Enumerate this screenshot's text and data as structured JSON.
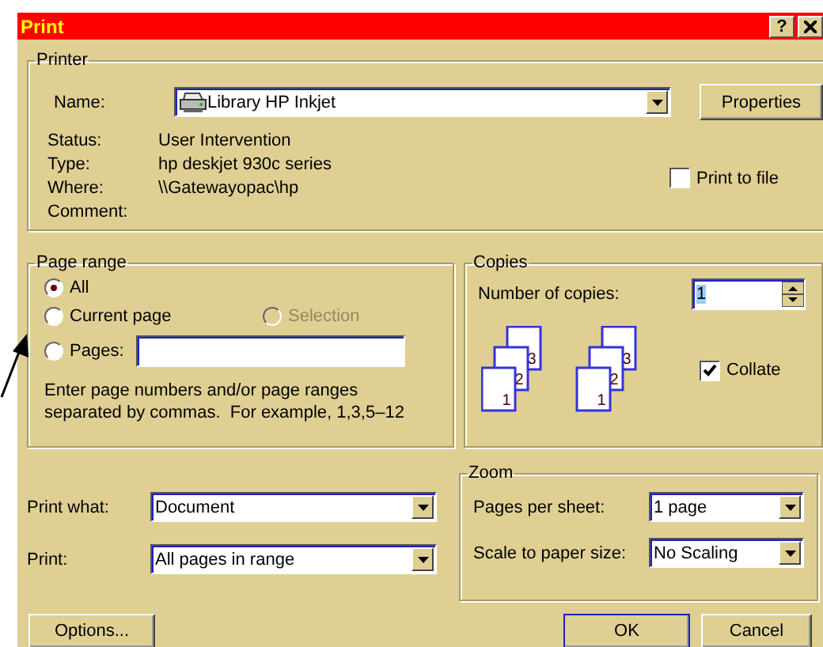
{
  "window": {
    "title": "Print",
    "help_button": "?"
  },
  "printer": {
    "label": "Printer",
    "name_label": "Name:",
    "name_value": "Library HP Inkjet",
    "properties_button": "Properties",
    "info": [
      {
        "label": "Status:",
        "value": "User Intervention"
      },
      {
        "label": "Type:",
        "value": "hp deskjet 930c series"
      },
      {
        "label": "Where:",
        "value": "\\\\Gatewayopac\\hp"
      },
      {
        "label": "Comment:"
      }
    ],
    "print_to_file": {
      "label": "Print to file",
      "checked": false
    }
  },
  "page_range": {
    "label": "Page range",
    "options": [
      {
        "label": "All",
        "selected": true,
        "disabled": false
      },
      {
        "label": "Current page",
        "selected": false,
        "disabled": false
      },
      {
        "label": "Selection",
        "selected": false,
        "disabled": true
      },
      {
        "label": "Pages:",
        "selected": false,
        "disabled": false
      }
    ],
    "hint": "Enter page numbers and/or page ranges separated by commas.  For example, 1,3,5–12"
  },
  "copies": {
    "label": "Copies",
    "number_label": "Number of copies:",
    "number_value": "1",
    "page_stacks": [
      [
        "1",
        "2",
        "3"
      ],
      [
        "1",
        "2",
        "3"
      ]
    ],
    "collate": {
      "label": "Collate",
      "checked": true
    }
  },
  "print_what": {
    "label": "Print what:",
    "value": "Document"
  },
  "print": {
    "label": "Print:",
    "value": "All pages in range"
  },
  "zoom": {
    "label": "Zoom",
    "pages_per_sheet": {
      "label": "Pages per sheet:",
      "value": "1 page"
    },
    "scale": {
      "label": "Scale to paper size:",
      "value": "No Scaling"
    }
  },
  "buttons": [
    {
      "label": "Options...",
      "default": false
    },
    {
      "label": "OK",
      "default": true
    },
    {
      "label": "Cancel",
      "default": false
    }
  ]
}
